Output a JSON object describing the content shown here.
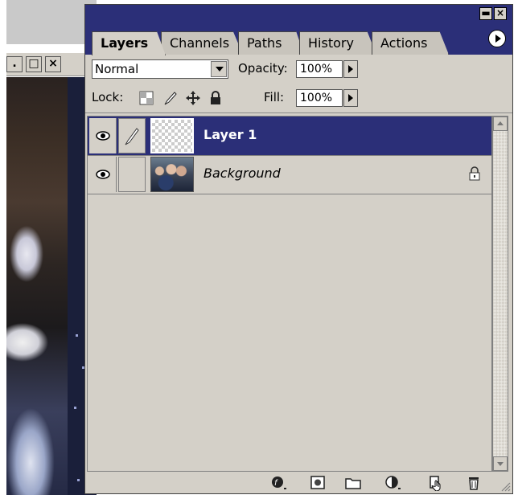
{
  "palette": {
    "tabs": [
      {
        "label": "Layers",
        "active": true
      },
      {
        "label": "Channels",
        "active": false
      },
      {
        "label": "Paths",
        "active": false
      },
      {
        "label": "History",
        "active": false
      },
      {
        "label": "Actions",
        "active": false
      }
    ],
    "blend_mode": "Normal",
    "opacity_label": "Opacity:",
    "opacity_value": "100%",
    "lock_label": "Lock:",
    "fill_label": "Fill:",
    "fill_value": "100%",
    "layers": [
      {
        "name": "Layer 1",
        "selected": true,
        "visible": true,
        "thumbnail": "transparent",
        "locked": false
      },
      {
        "name": "Background",
        "selected": false,
        "visible": true,
        "thumbnail": "photo",
        "locked": true
      }
    ],
    "bottom_icons": [
      "layer-style-icon",
      "layer-mask-icon",
      "new-group-icon",
      "adjustment-layer-icon",
      "new-layer-icon",
      "trash-icon"
    ]
  },
  "colors": {
    "titlebar": "#2b2f78",
    "panel": "#d4d0c8",
    "selection": "#2b2f78"
  }
}
